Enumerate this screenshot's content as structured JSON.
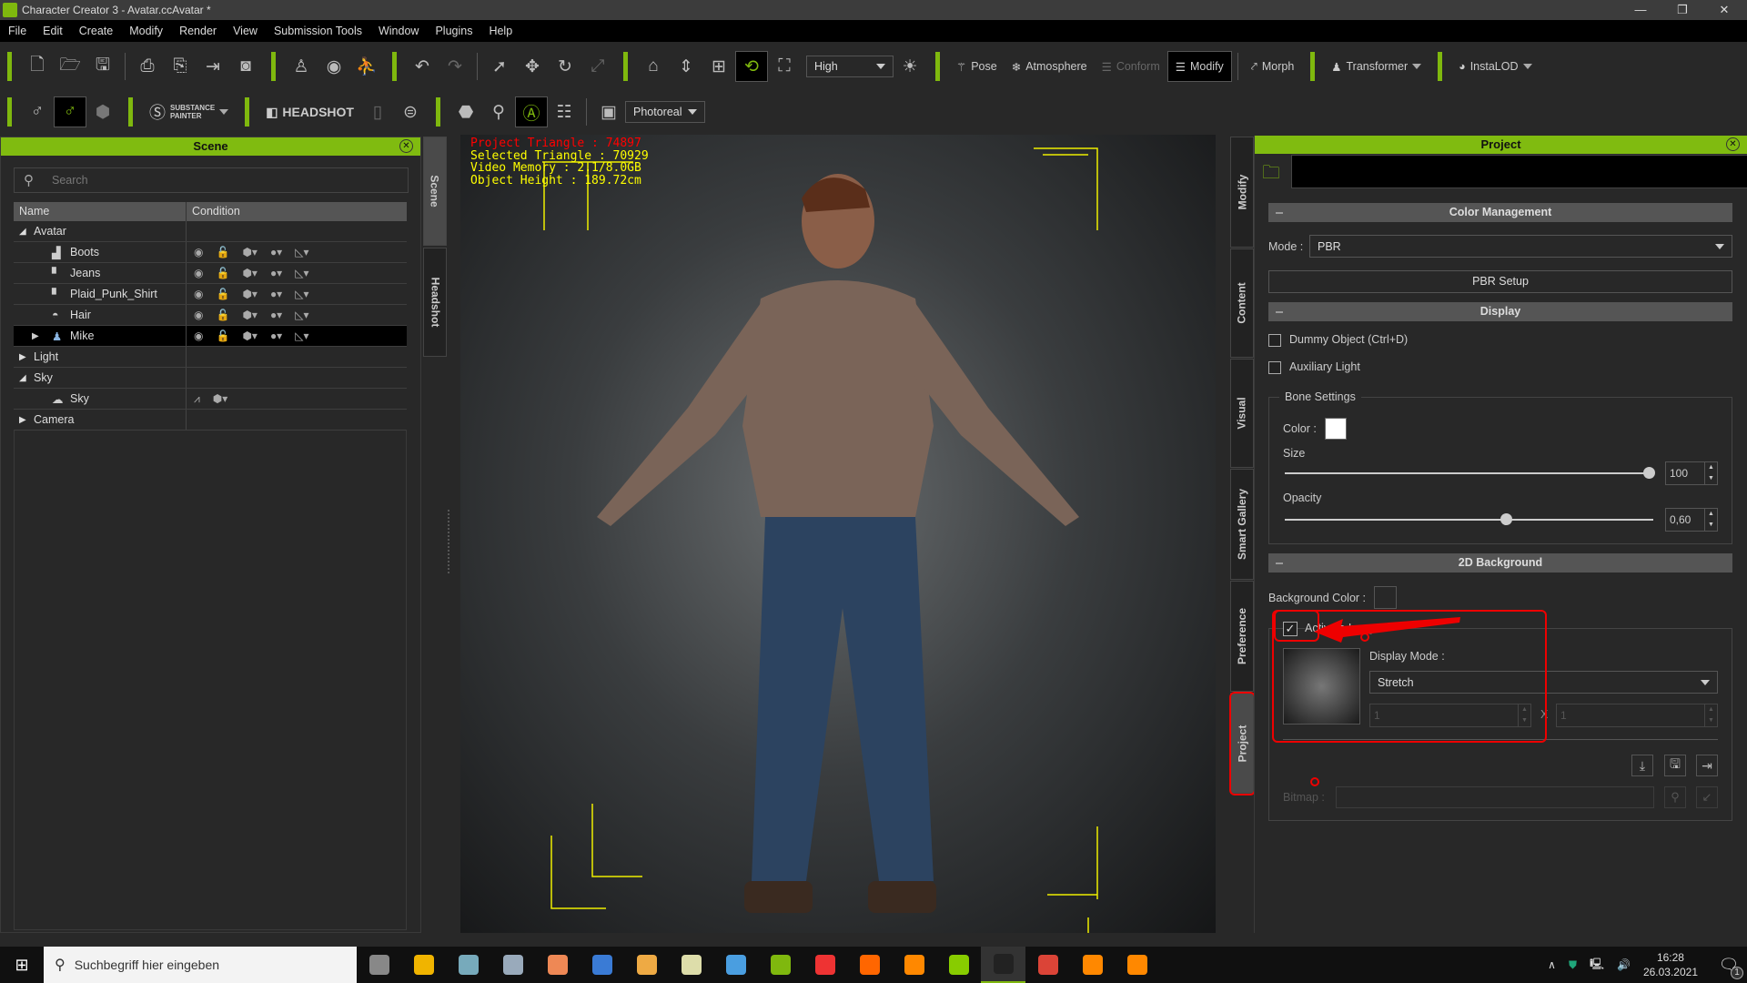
{
  "window": {
    "title": "Character Creator 3 - Avatar.ccAvatar *",
    "controls": [
      "—",
      "❐",
      "✕"
    ]
  },
  "menu": [
    "File",
    "Edit",
    "Create",
    "Modify",
    "Render",
    "View",
    "Submission Tools",
    "Window",
    "Plugins",
    "Help"
  ],
  "toolbar1": {
    "quality": "High",
    "pose": "Pose",
    "atmosphere": "Atmosphere",
    "conform": "Conform",
    "modify": "Modify",
    "morph": "Morph",
    "transformer": "Transformer",
    "instalod": "InstaLOD"
  },
  "toolbar2": {
    "substance_line1": "SUBSTANCE",
    "substance_line2": "PAINTER",
    "headshot": "HEADSHOT",
    "render_mode": "Photoreal"
  },
  "scene": {
    "title": "Scene",
    "search_placeholder": "Search",
    "columns": [
      "Name",
      "Condition"
    ],
    "rows": [
      {
        "name": "Avatar",
        "level": 0,
        "expander": "open"
      },
      {
        "name": "Boots",
        "level": 1,
        "icon": "boots-icon",
        "cond": true
      },
      {
        "name": "Jeans",
        "level": 1,
        "icon": "clothing-icon",
        "cond": true
      },
      {
        "name": "Plaid_Punk_Shirt",
        "level": 1,
        "icon": "clothing-icon",
        "cond": true
      },
      {
        "name": "Hair",
        "level": 1,
        "icon": "hair-icon",
        "cond": true
      },
      {
        "name": "Mike",
        "level": 1,
        "icon": "person-icon",
        "cond": true,
        "expander": "closed",
        "selected": true
      },
      {
        "name": "Light",
        "level": 0,
        "expander": "closed"
      },
      {
        "name": "Sky",
        "level": 0,
        "expander": "open"
      },
      {
        "name": "Sky",
        "level": 1,
        "icon": "sky-icon",
        "sky": true
      },
      {
        "name": "Camera",
        "level": 0,
        "expander": "closed"
      }
    ]
  },
  "left_tabs": [
    "Scene",
    "Headshot"
  ],
  "viewport": {
    "project_triangle": "Project Triangle : 74897",
    "selected_triangle": "Selected Triangle : 70929",
    "video_memory": "Video Memory : 2.1/8.0GB",
    "object_height": "Object Height : 189.72cm"
  },
  "right_tabs": [
    "Modify",
    "Content",
    "Visual",
    "Smart Gallery",
    "Preference",
    "Project"
  ],
  "project": {
    "title": "Project",
    "color_management": {
      "header": "Color Management",
      "mode_label": "Mode :",
      "mode_value": "PBR",
      "pbr_setup": "PBR Setup"
    },
    "display": {
      "header": "Display",
      "dummy": "Dummy Object (Ctrl+D)",
      "dummy_checked": false,
      "aux": "Auxiliary Light",
      "aux_checked": false,
      "bone": {
        "group": "Bone Settings",
        "color_label": "Color :",
        "color": "#ffffff",
        "size_label": "Size",
        "size": "100",
        "size_fraction": 1.0,
        "opacity_label": "Opacity",
        "opacity": "0,60",
        "opacity_fraction": 0.6
      }
    },
    "bg2d": {
      "header": "2D Background",
      "bg_color_label": "Background Color :",
      "bg_color": "#282828",
      "activate": "Activate Image",
      "activate_checked": true,
      "display_mode_label": "Display Mode :",
      "display_mode": "Stretch",
      "tile_x": "1",
      "x": "X",
      "tile_y": "1",
      "bitmap_label": "Bitmap :"
    }
  },
  "taskbar": {
    "search_placeholder": "Suchbegriff hier eingeben",
    "time": "16:28",
    "date": "26.03.2021",
    "notif": "1",
    "apps": [
      "#888",
      "#f0b400",
      "#7ab",
      "#9ab",
      "#e85",
      "#3a7bd5",
      "#ea4",
      "#dda",
      "#4a9ee0",
      "#7fb80e",
      "#e33",
      "#f60",
      "#f80",
      "#8c0",
      "#222",
      "#db4437",
      "#f80",
      "#f80"
    ]
  },
  "accent": "#80bb10",
  "annotation": "#ee0000"
}
